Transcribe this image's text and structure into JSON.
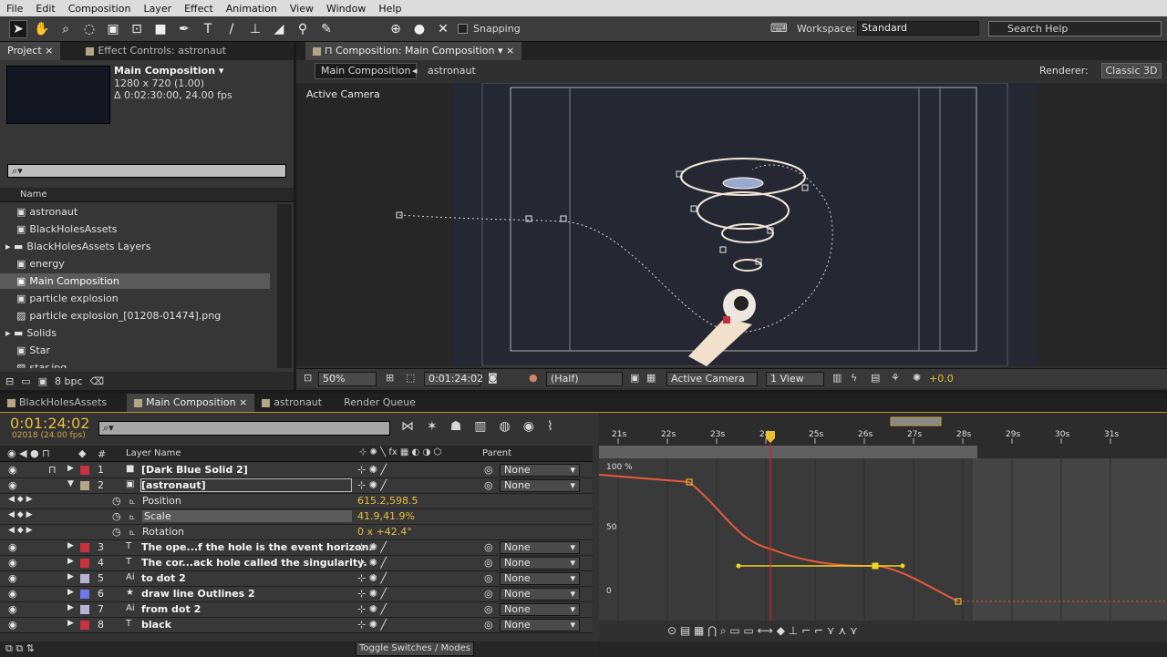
{
  "menu": [
    "File",
    "Edit",
    "Composition",
    "Layer",
    "Effect",
    "Animation",
    "View",
    "Window",
    "Help"
  ],
  "toolbar": {
    "snapping": "Snapping",
    "workspace_label": "Workspace:",
    "workspace": "Standard",
    "search_placeholder": "Search Help"
  },
  "project": {
    "tab": "Project",
    "effect_tab": "Effect Controls: astronaut",
    "comp_name": "Main Composition",
    "comp_size": "1280 x 720 (1.00)",
    "comp_duration": "Δ 0:02:30:00, 24.00 fps",
    "col_name": "Name",
    "bpc": "8 bpc",
    "items": [
      {
        "name": "astronaut",
        "type": "comp"
      },
      {
        "name": "BlackHolesAssets",
        "type": "comp"
      },
      {
        "name": "BlackHolesAssets Layers",
        "type": "folder"
      },
      {
        "name": "energy",
        "type": "comp"
      },
      {
        "name": "Main Composition",
        "type": "comp",
        "selected": true
      },
      {
        "name": "particle explosion",
        "type": "comp"
      },
      {
        "name": "particle explosion_[01208-01474].png",
        "type": "image"
      },
      {
        "name": "Solids",
        "type": "folder"
      },
      {
        "name": "Star",
        "type": "comp"
      },
      {
        "name": "star.jpg",
        "type": "image"
      }
    ]
  },
  "composition": {
    "tab": "Composition: Main Composition",
    "crumbs": [
      "Main Composition",
      "astronaut"
    ],
    "renderer_label": "Renderer:",
    "renderer": "Classic 3D",
    "camera_label": "Active Camera",
    "bottom": {
      "zoom": "50%",
      "timecode": "0:01:24:02",
      "resolution": "(Half)",
      "camera": "Active Camera",
      "views": "1 View",
      "exposure": "+0.0"
    }
  },
  "timeline": {
    "tabs": [
      "BlackHolesAssets",
      "Main Composition",
      "astronaut",
      "Render Queue"
    ],
    "active_tab": 1,
    "timecode": "0:01:24:02",
    "frame_info": "02018 (24.00 fps)",
    "headers": {
      "num": "#",
      "layer_name": "Layer Name",
      "parent": "Parent"
    },
    "layers": [
      {
        "num": "1",
        "name": "[Dark Blue Solid 2]",
        "color": "#c8323c",
        "parent": "None",
        "icon": "solid"
      },
      {
        "num": "2",
        "name": "[astronaut]",
        "color": "#b4a584",
        "parent": "None",
        "icon": "comp",
        "expanded": true
      },
      {
        "num": "3",
        "name": "The ope...f the hole is the event horizon.",
        "color": "#c8323c",
        "parent": "None",
        "icon": "text"
      },
      {
        "num": "4",
        "name": "The cor...ack hole called the singularity.",
        "color": "#c8323c",
        "parent": "None",
        "icon": "text"
      },
      {
        "num": "5",
        "name": "to dot 2",
        "color": "#b4b4d2",
        "parent": "None",
        "icon": "ai"
      },
      {
        "num": "6",
        "name": "draw line Outlines 2",
        "color": "#6e78e6",
        "parent": "None",
        "icon": "shape"
      },
      {
        "num": "7",
        "name": "from dot 2",
        "color": "#b4b4d2",
        "parent": "None",
        "icon": "ai"
      },
      {
        "num": "8",
        "name": "black",
        "color": "#c8323c",
        "parent": "None",
        "icon": "text"
      }
    ],
    "properties": [
      {
        "name": "Position",
        "value": "615.2,598.5"
      },
      {
        "name": "Scale",
        "value": "41.9,41.9%",
        "selected": true
      },
      {
        "name": "Rotation",
        "value": "0 x +42.4°"
      }
    ],
    "toggle_label": "Toggle Switches / Modes",
    "ruler": [
      "21s",
      "22s",
      "23s",
      "24s",
      "25s",
      "26s",
      "27s",
      "28s",
      "29s",
      "30s",
      "31s"
    ],
    "graph_labels": [
      "100 %",
      "50",
      "0"
    ]
  }
}
